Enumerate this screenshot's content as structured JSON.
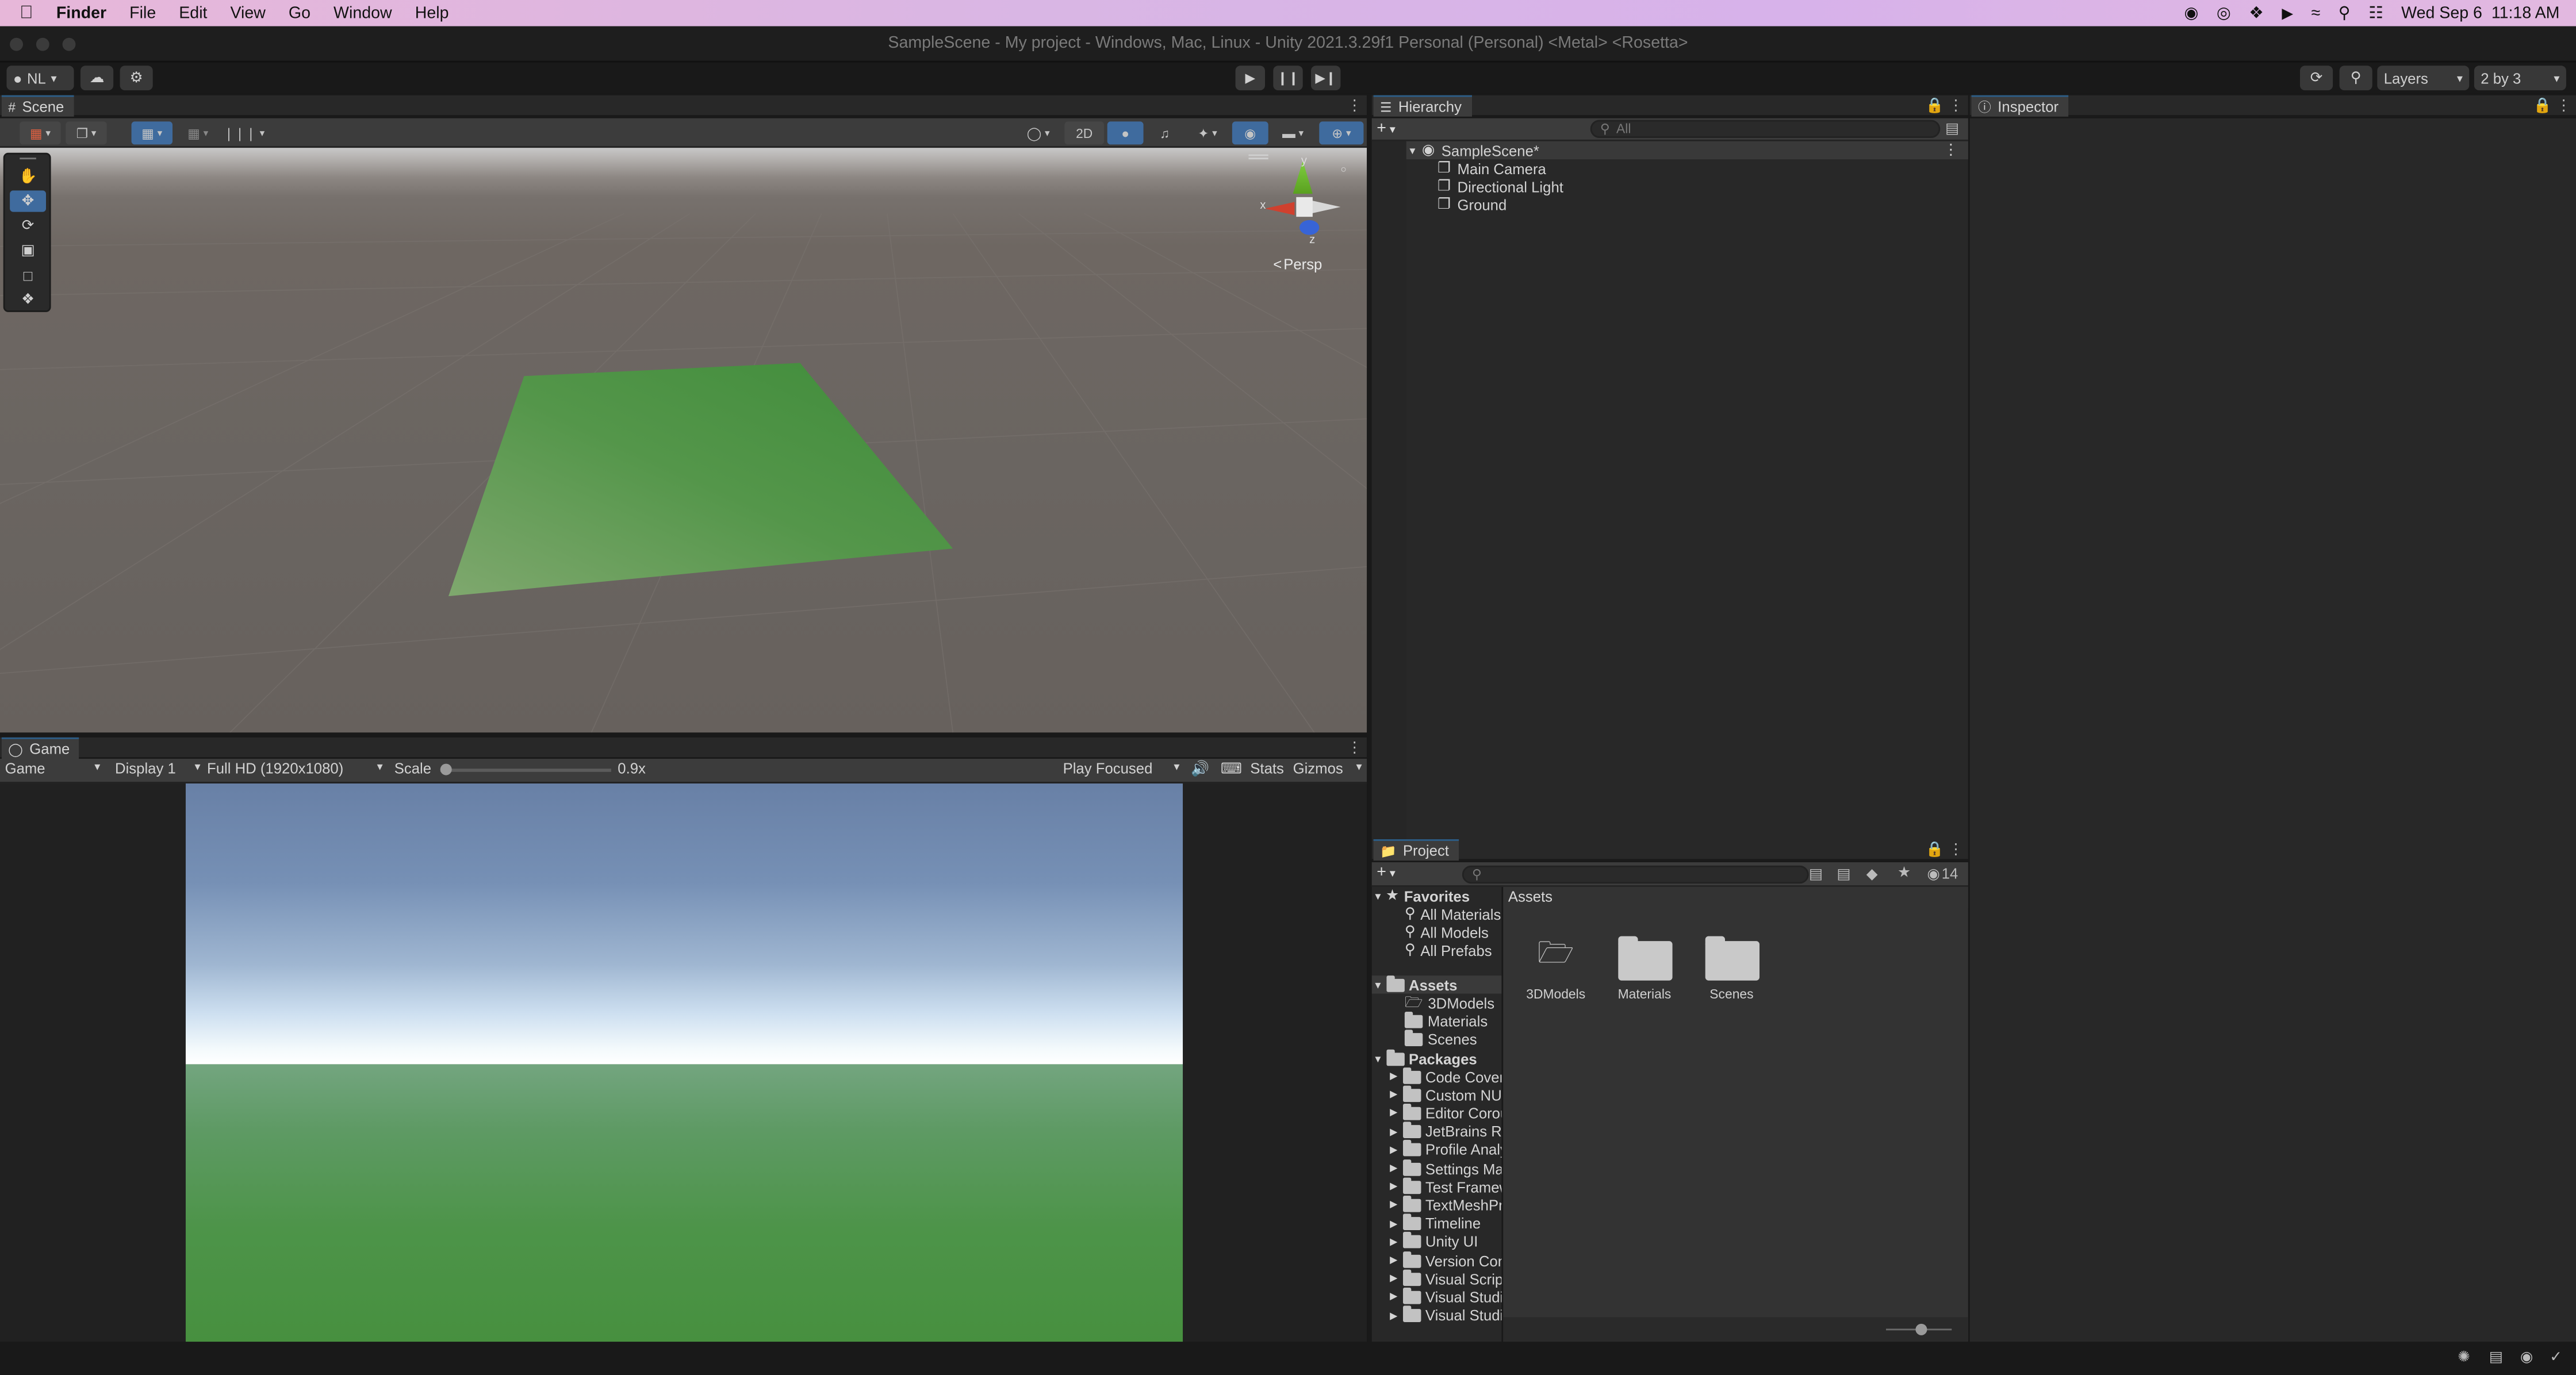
{
  "menubar": {
    "app": "Finder",
    "items": [
      "File",
      "Edit",
      "View",
      "Go",
      "Window",
      "Help"
    ],
    "clock": "Wed Sep 6  11:18 AM"
  },
  "window": {
    "title": "SampleScene - My project - Windows, Mac, Linux - Unity 2021.3.29f1 Personal (Personal) <Metal> <Rosetta>"
  },
  "toolbar": {
    "account": "NL",
    "layers_label": "Layers",
    "layout_label": "2 by 3"
  },
  "scene": {
    "tab_label": "Scene",
    "mode_2d": "2D",
    "gizmo_persp": "Persp",
    "axis_x": "x",
    "axis_y": "y",
    "axis_z": "z"
  },
  "game": {
    "tab_label": "Game",
    "view_select": "Game",
    "display_select": "Display 1",
    "resolution_select": "Full HD (1920x1080)",
    "scale_label": "Scale",
    "scale_value": "0.9x",
    "play_mode_select": "Play Focused",
    "stats_label": "Stats",
    "gizmos_label": "Gizmos",
    "scale_fraction": 0.02
  },
  "hierarchy": {
    "tab_label": "Hierarchy",
    "search_placeholder": "All",
    "scene_name": "SampleScene*",
    "objects": [
      "Main Camera",
      "Directional Light",
      "Ground"
    ]
  },
  "inspector": {
    "tab_label": "Inspector"
  },
  "project": {
    "tab_label": "Project",
    "hidden_count": "14",
    "favorites_label": "Favorites",
    "favorites": [
      "All Materials",
      "All Models",
      "All Prefabs"
    ],
    "assets_label": "Assets",
    "assets": [
      "3DModels",
      "Materials",
      "Scenes"
    ],
    "packages_label": "Packages",
    "packages": [
      "Code Coverage",
      "Custom NUnit",
      "Editor Coroutines",
      "JetBrains Rider Editor",
      "Profile Analyzer",
      "Settings Manager",
      "Test Framework",
      "TextMeshPro",
      "Timeline",
      "Unity UI",
      "Version Control",
      "Visual Scripting",
      "Visual Studio Code Editor",
      "Visual Studio Editor"
    ],
    "breadcrumb": "Assets",
    "grid_items": [
      "3DModels",
      "Materials",
      "Scenes"
    ]
  },
  "colors": {
    "ground_green": "#4f9a43",
    "accent_blue": "#3f6b9e"
  }
}
